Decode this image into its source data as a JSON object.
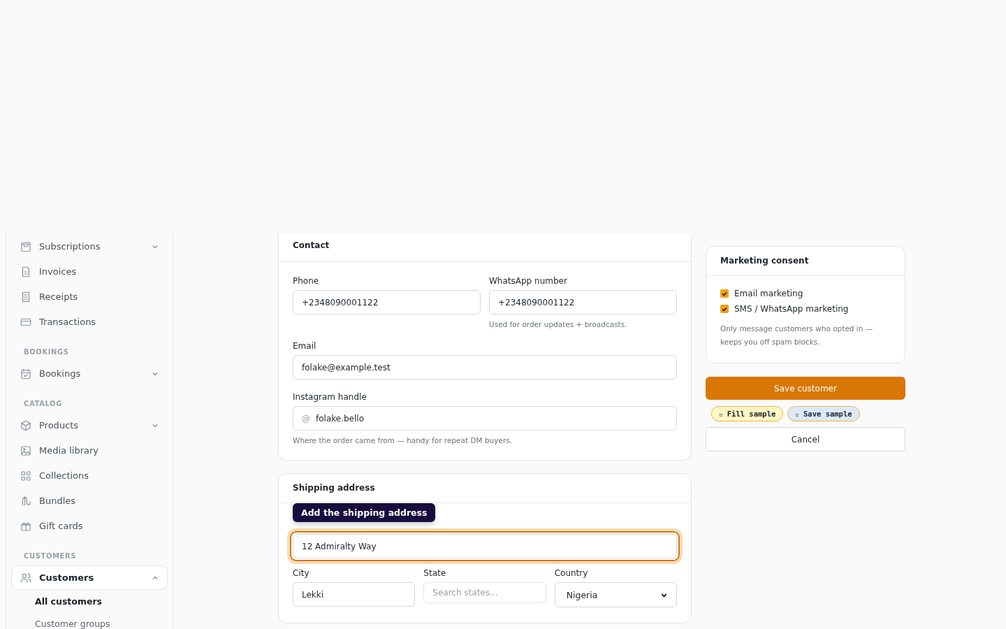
{
  "sidebar": {
    "groups": [
      {
        "items": [
          {
            "label": "Subscriptions",
            "expanded": false,
            "selected": false
          },
          {
            "label": "Invoices",
            "selected": false
          },
          {
            "label": "Receipts",
            "selected": false
          },
          {
            "label": "Transactions",
            "selected": false
          }
        ]
      },
      {
        "heading": "BOOKINGS",
        "items": [
          {
            "label": "Bookings",
            "expanded": false,
            "selected": false
          }
        ]
      },
      {
        "heading": "CATALOG",
        "items": [
          {
            "label": "Products",
            "expanded": false,
            "selected": false
          },
          {
            "label": "Media library",
            "selected": false
          },
          {
            "label": "Collections",
            "selected": false
          },
          {
            "label": "Bundles",
            "selected": false
          },
          {
            "label": "Gift cards",
            "selected": false
          }
        ]
      },
      {
        "heading": "CUSTOMERS",
        "items": [
          {
            "label": "Customers",
            "expanded": true,
            "selected": true,
            "children": [
              {
                "label": "All customers",
                "selected": true
              },
              {
                "label": "Customer groups",
                "selected": false
              }
            ]
          }
        ]
      }
    ]
  },
  "contact": {
    "title": "Contact",
    "phone": {
      "label": "Phone",
      "value": "+2348090001122"
    },
    "whatsapp": {
      "label": "WhatsApp number",
      "value": "+2348090001122",
      "help": "Used for order updates + broadcasts."
    },
    "email": {
      "label": "Email",
      "value": "folake@example.test"
    },
    "instagram": {
      "label": "Instagram handle",
      "prefix": "@",
      "value": "folake.bello",
      "help": "Where the order came from — handy for repeat DM buyers."
    }
  },
  "shipping": {
    "title": "Shipping address",
    "tooltip": "Add the shipping address",
    "street": {
      "value": "12 Admiralty Way",
      "focused": true
    },
    "city": {
      "label": "City",
      "value": "Lekki"
    },
    "state": {
      "label": "State",
      "placeholder": "Search states..."
    },
    "country": {
      "label": "Country",
      "value": "Nigeria"
    }
  },
  "consent": {
    "title": "Marketing consent",
    "options": [
      {
        "label": "Email marketing",
        "checked": true
      },
      {
        "label": "SMS / WhatsApp marketing",
        "checked": true
      }
    ],
    "note": "Only message customers who opted in — keeps you off spam blocks."
  },
  "save_button": "Save customer",
  "sample_buttons": [
    {
      "icon": "▫",
      "label": "Fill sample",
      "color": "#fef6c4"
    },
    {
      "icon": "▫",
      "label": "Save sample",
      "color": "#dbe9fb"
    }
  ],
  "cancel_button": "Cancel"
}
